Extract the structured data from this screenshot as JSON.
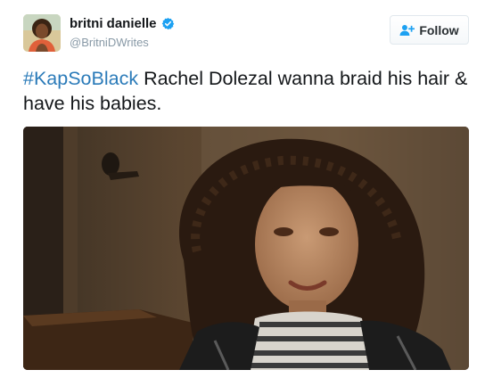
{
  "user": {
    "display_name": "britni danielle",
    "handle": "@BritniDWrites",
    "verified": true
  },
  "follow_button": {
    "label": "Follow"
  },
  "tweet": {
    "hashtag": "#KapSoBlack",
    "text": " Rachel Dolezal wanna braid his hair & have his babies."
  },
  "colors": {
    "link": "#2b7bb9",
    "verified": "#1da1f2",
    "handle": "#8899a6"
  },
  "icons": [
    "verified-badge-icon",
    "follow-person-plus-icon"
  ]
}
